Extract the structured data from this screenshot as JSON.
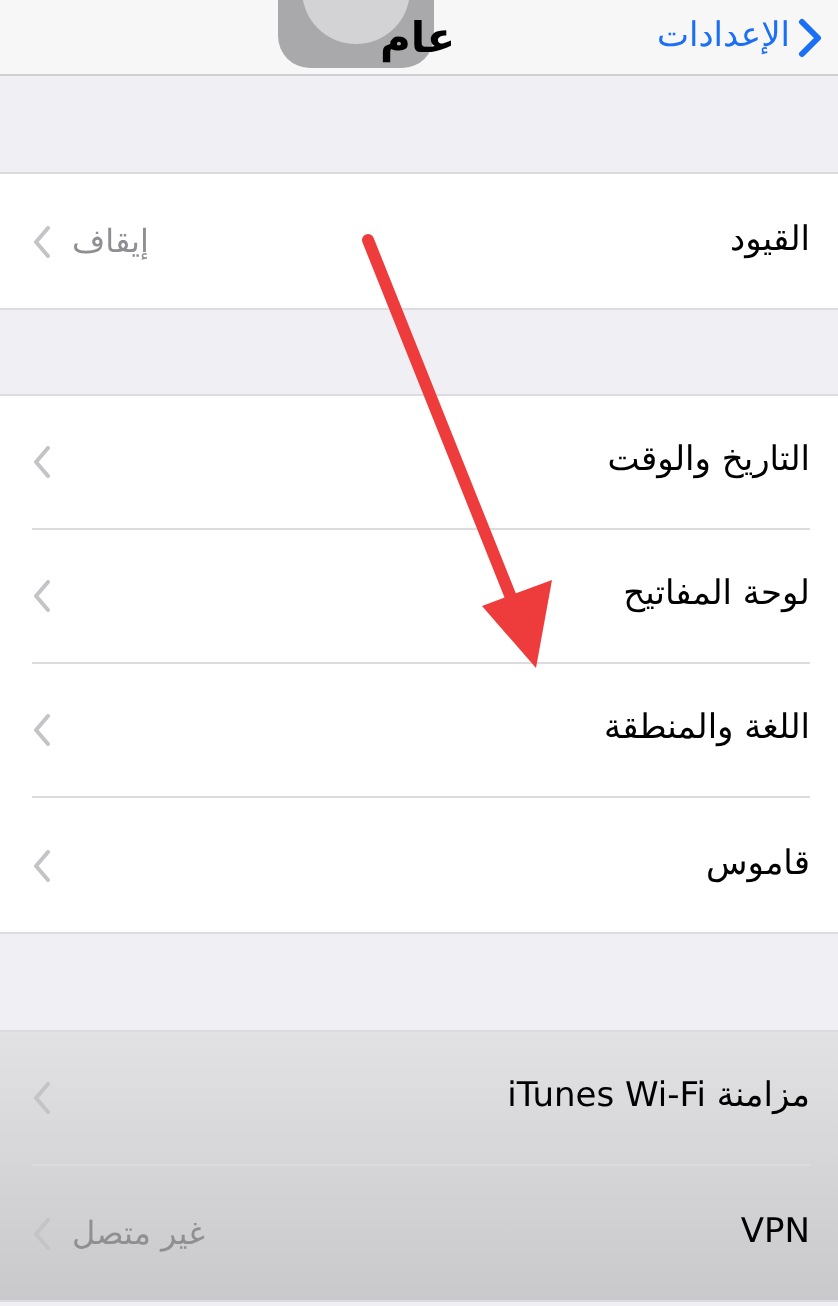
{
  "nav": {
    "back_label": "الإعدادات",
    "title": "عام"
  },
  "sections": [
    {
      "rows": [
        {
          "label": "القيود",
          "value": "إيقاف"
        }
      ]
    },
    {
      "rows": [
        {
          "label": "التاريخ والوقت"
        },
        {
          "label": "لوحة المفاتيح"
        },
        {
          "label": "اللغة والمنطقة"
        },
        {
          "label": "قاموس"
        }
      ]
    },
    {
      "rows": [
        {
          "label": "مزامنة iTunes Wi-Fi"
        },
        {
          "label": "VPN",
          "value": "غير متصل"
        }
      ]
    }
  ]
}
